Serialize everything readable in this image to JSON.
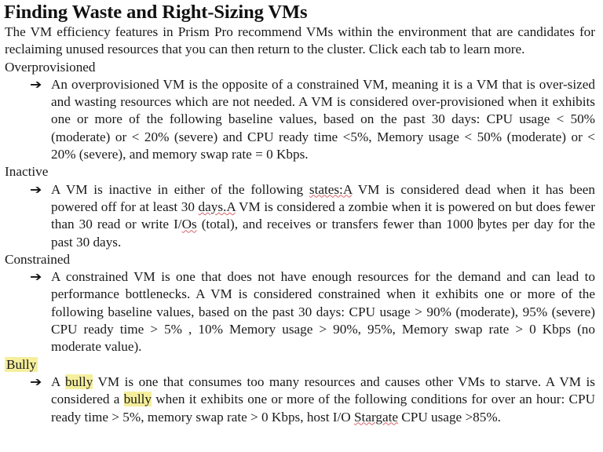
{
  "document": {
    "title": "Finding Waste and Right-Sizing VMs",
    "intro": "The VM efficiency features in Prism Pro recommend VMs within the environment that are candidates for reclaiming unused resources that you can then return to the cluster. Click each tab to learn more.",
    "bullet_glyph": "➔",
    "highlight_color": "#f5ef9d",
    "spellcheck_underline_color": "#d8636b",
    "sections": [
      {
        "heading": "Overprovisioned",
        "heading_highlighted": false,
        "body": "An overprovisioned VM is the opposite of a constrained VM, meaning it is a VM that is over-sized and wasting resources which are not needed. A VM is considered over-provisioned when it exhibits one or more of the following baseline values, based on the past 30 days: CPU usage < 50% (moderate) or < 20% (severe) and CPU ready time <5%, Memory usage < 50% (moderate) or < 20% (severe), and memory swap rate = 0 Kbps."
      },
      {
        "heading": "Inactive",
        "heading_highlighted": false,
        "body_parts": [
          {
            "text": "A VM is inactive in either of the following ",
            "style": "plain"
          },
          {
            "text": "states:A",
            "style": "spellcheck"
          },
          {
            "text": " VM is considered dead when it has been powered off for at least 30 ",
            "style": "plain"
          },
          {
            "text": "days.A",
            "style": "spellcheck"
          },
          {
            "text": " VM is considered a zombie when it is powered on but does fewer than 30 read or write I/",
            "style": "plain"
          },
          {
            "text": "Os",
            "style": "spellcheck"
          },
          {
            "text": " (total), and receives or transfers fewer than 1000 ",
            "style": "plain"
          },
          {
            "text": "bytes per day for the past 30 days.",
            "style": "caret-before"
          }
        ]
      },
      {
        "heading": "Constrained",
        "heading_highlighted": false,
        "body": "A constrained VM is one that does not have enough resources for the demand and can lead to performance bottlenecks. A VM is considered constrained when it exhibits one or more of the following baseline values, based on the past 30 days: CPU usage > 90% (moderate), 95% (severe) CPU ready time > 5% , 10% Memory usage > 90%, 95%, Memory swap rate > 0 Kbps (no moderate value)."
      },
      {
        "heading": "Bully",
        "heading_highlighted": true,
        "body_parts": [
          {
            "text": "A ",
            "style": "plain"
          },
          {
            "text": "bully",
            "style": "highlight"
          },
          {
            "text": " VM is one that consumes too many resources and causes other VMs to starve. A VM is considered a ",
            "style": "plain"
          },
          {
            "text": "bully",
            "style": "highlight"
          },
          {
            "text": " when it exhibits one or more of the following conditions for over an hour: CPU ready time > 5%, memory swap rate > 0 Kbps, host I/O ",
            "style": "plain"
          },
          {
            "text": "Stargate",
            "style": "spellcheck"
          },
          {
            "text": " CPU usage >85%.",
            "style": "plain"
          }
        ]
      }
    ]
  }
}
